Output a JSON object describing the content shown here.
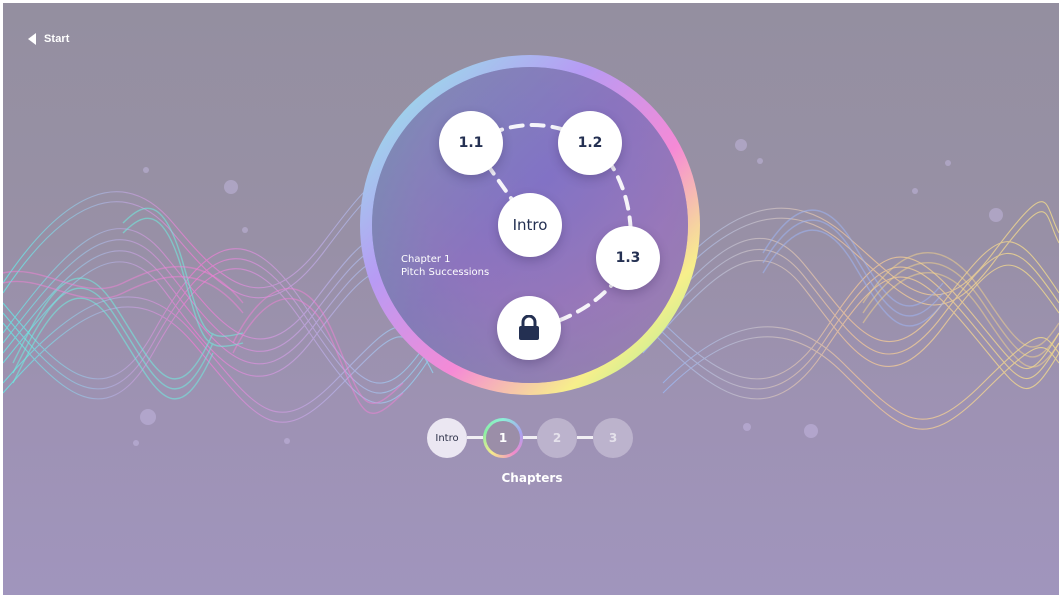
{
  "header": {
    "back_label": "Start",
    "back_icon": "caret-left-icon"
  },
  "chapter": {
    "caption_line1": "Chapter 1",
    "caption_line2": "Pitch Successions",
    "nodes": {
      "intro": "Intro",
      "n11": "1.1",
      "n12": "1.2",
      "n13": "1.3",
      "locked_icon": "lock-icon"
    }
  },
  "progress": {
    "steps": [
      {
        "label": "Intro",
        "state": "visited"
      },
      {
        "label": "1",
        "state": "current"
      },
      {
        "label": "2",
        "state": "locked"
      },
      {
        "label": "3",
        "state": "locked"
      }
    ],
    "title": "Chapters"
  },
  "colors": {
    "node_text": "#243052",
    "background": "#9890a6",
    "ring_cyan": "#8ff5e6",
    "ring_violet": "#b79bf4",
    "ring_pink": "#f58ad6",
    "ring_yellow": "#f7ef8b",
    "ring_green": "#8ff09f"
  }
}
